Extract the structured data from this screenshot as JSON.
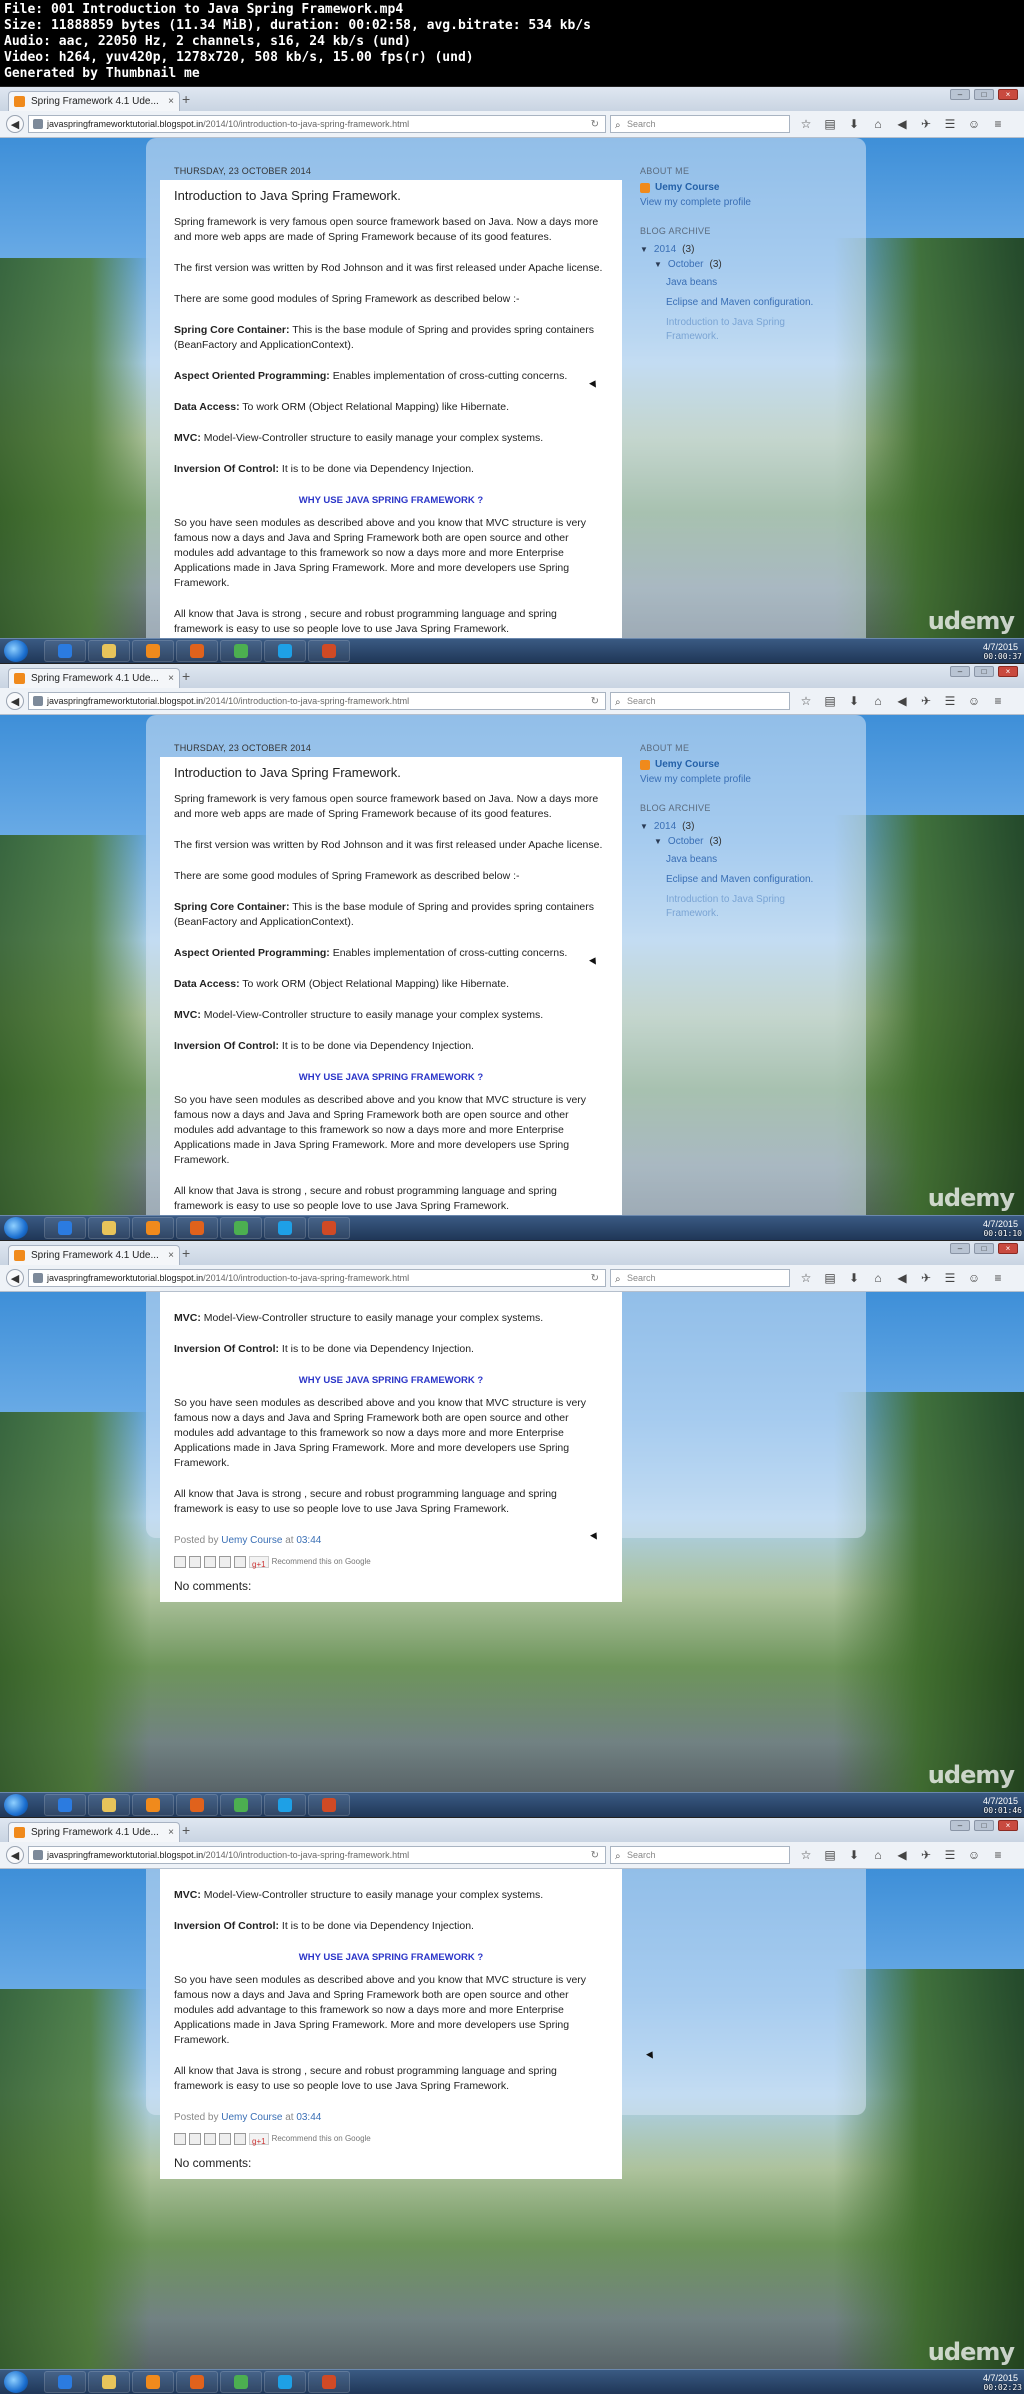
{
  "meta_lines": [
    "File: 001 Introduction to Java Spring Framework.mp4",
    "Size: 11888859 bytes (11.34 MiB), duration: 00:02:58, avg.bitrate: 534 kb/s",
    "Audio: aac, 22050 Hz, 2 channels, s16, 24 kb/s (und)",
    "Video: h264, yuv420p, 1278x720, 508 kb/s, 15.00 fps(r) (und)",
    "Generated by Thumbnail me"
  ],
  "browser": {
    "tab_title": "Spring Framework 4.1 Ude...",
    "tab_close": "×",
    "new_tab": "+",
    "url_host": "javaspringframeworktutorial.blogspot.in",
    "url_path": "/2014/10/introduction-to-java-spring-framework.html",
    "reload": "↻",
    "search_placeholder": "Search",
    "tool_icons": [
      "☆",
      "▤",
      "⬇",
      "⌂",
      "◀",
      "✈",
      "☰",
      "☺",
      "≡"
    ]
  },
  "post": {
    "date": "THURSDAY, 23 OCTOBER 2014",
    "title": "Introduction to Java Spring Framework.",
    "intro": "Spring framework is very famous open source framework based on Java. Now a days more and more web apps are made of Spring Framework because of its good features.",
    "first_version": "The first version was written by Rod Johnson and it was first released under Apache license.",
    "modules_intro": "There are some good modules of Spring Framework as described below :-",
    "modules": [
      {
        "name": "Spring Core Container:",
        "desc": " This is the base module of Spring and provides spring containers (BeanFactory and ApplicationContext)."
      },
      {
        "name": "Aspect Oriented Programming:",
        "desc": " Enables implementation of cross-cutting concerns."
      },
      {
        "name": "Data Access:",
        "desc": " To work ORM (Object Relational Mapping) like Hibernate."
      },
      {
        "name": "MVC:",
        "desc": " Model-View-Controller structure to easily manage your complex systems."
      },
      {
        "name": "Inversion Of Control:",
        "desc": " It is to be done via Dependency Injection."
      }
    ],
    "why_heading": "WHY USE JAVA SPRING FRAMEWORK ?",
    "why_text": "So you have seen modules as described above and you know that MVC structure is very famous now a days and Java and Spring Framework both are open source and other modules add advantage to this framework so now a days more and more Enterprise Applications made in Java Spring Framework. More and more developers use Spring Framework.",
    "closing": "All know that Java is strong , secure and robust programming language and spring framework is easy to use so people love to use Java Spring Framework.",
    "posted_by": "Posted by",
    "author": "Uemy Course",
    "at": "at",
    "time": "03:44",
    "gplus": "g+1",
    "recommend": "Recommend this on Google",
    "comments": "No comments:"
  },
  "sidebar": {
    "about_heading": "ABOUT ME",
    "user": "Uemy Course",
    "profile_link": "View my complete profile",
    "archive_heading": "BLOG ARCHIVE",
    "year": "2014",
    "year_count": "(3)",
    "month": "October",
    "month_count": "(3)",
    "posts": [
      "Java beans",
      "Eclipse and Maven configuration.",
      "Introduction to Java Spring Framework."
    ],
    "year_partial": "2014 (3)"
  },
  "taskbar": {
    "watermark": "udemy",
    "clock_date": "4/7/2015"
  },
  "frames": [
    {
      "timestamp": "00:00:37"
    },
    {
      "timestamp": "00:01:10"
    },
    {
      "timestamp": "00:01:46"
    },
    {
      "timestamp": "00:02:23"
    }
  ]
}
